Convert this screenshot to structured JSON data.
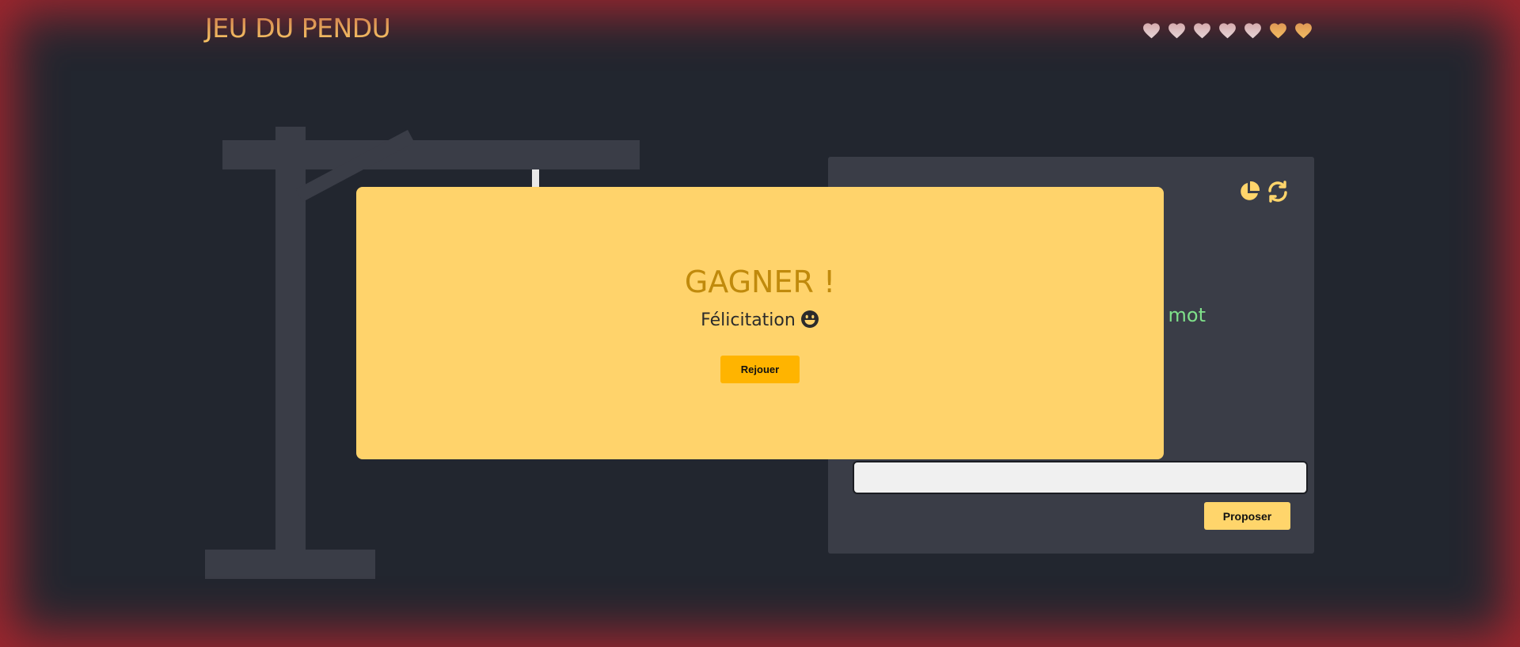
{
  "header": {
    "title": "JEU DU PENDU"
  },
  "lives": {
    "total": 7,
    "lost": 5,
    "remaining": 2,
    "hearts": [
      "lost",
      "lost",
      "lost",
      "lost",
      "lost",
      "remaining",
      "remaining"
    ]
  },
  "panel": {
    "message_visible_fragment": "e mot",
    "guess_input": {
      "value": "",
      "placeholder": ""
    },
    "propose_label": "Proposer",
    "icons": [
      "stats-pie-icon",
      "refresh-icon"
    ]
  },
  "modal": {
    "title": "GAGNER !",
    "subtitle": "Félicitation",
    "subtitle_icon": "grinning-face-icon",
    "replay_label": "Rejouer"
  },
  "colors": {
    "background": "#22262f",
    "accent": "#ffd56b",
    "modal_background": "#ffd36b",
    "modal_title": "#c08a0c",
    "replay_button": "#ffb400",
    "panel": "#3a3d47",
    "heart_lost": "#f2f2f2",
    "heart_remaining": "#ffd56b",
    "message": "#7fe08a",
    "vignette": "#a1262e"
  }
}
